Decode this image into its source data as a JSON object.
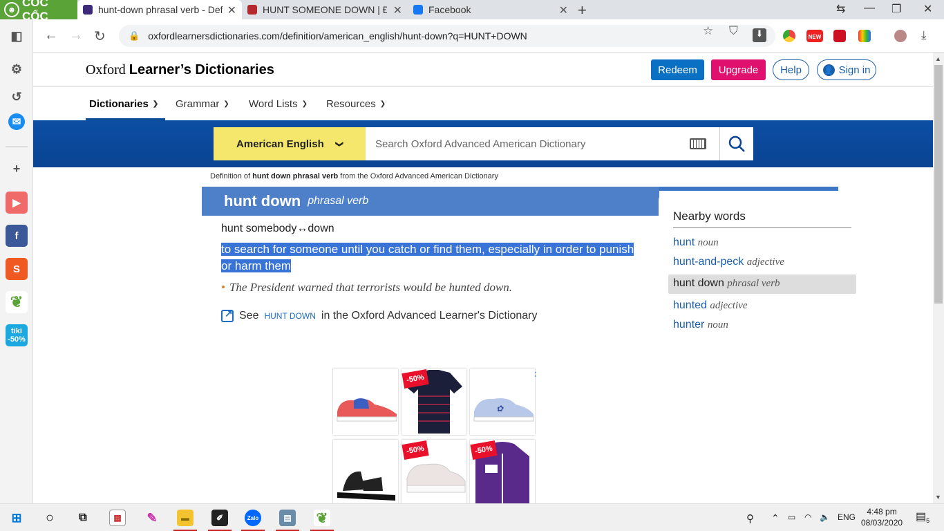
{
  "browser": {
    "brand": "CỐC CỐC",
    "tabs": [
      {
        "title": "hunt-down phrasal verb - Def"
      },
      {
        "title": "HUNT SOMEONE DOWN | Đị"
      },
      {
        "title": "Facebook"
      }
    ],
    "url": "oxfordlearnersdictionaries.com/definition/american_english/hunt-down?q=HUNT+DOWN",
    "ext_new_badge": "NEW"
  },
  "sidebar": {
    "tiki_label": "tiki",
    "tiki_discount": "-50%"
  },
  "site": {
    "title_oxford": "Oxford",
    "title_rest": "Learner’s Dictionaries",
    "redeem": "Redeem",
    "upgrade": "Upgrade",
    "help": "Help",
    "signin": "Sign in",
    "nav": [
      "Dictionaries",
      "Grammar",
      "Word Lists",
      "Resources"
    ]
  },
  "search": {
    "dictionary": "American English",
    "placeholder": "Search Oxford Advanced American Dictionary"
  },
  "entry": {
    "definition_of_prefix": "Definition of",
    "definition_of_term": "hunt down phrasal verb",
    "definition_of_suffix": "from the Oxford Advanced American Dictionary",
    "headword": "hunt down",
    "pos": "phrasal verb",
    "phrase": "hunt somebody↔down",
    "definition": "to search for someone until you catch or find them, especially in order to punish or harm them",
    "example": "The President warned that terrorists would be hunted down.",
    "see_prefix": "See",
    "see_term": "hunt down",
    "see_suffix": "in the Oxford Advanced Learner's Dictionary"
  },
  "nearby": {
    "title": "Nearby words",
    "items": [
      {
        "word": "hunt",
        "pos": "noun"
      },
      {
        "word": "hunt-and-peck",
        "pos": "adjective"
      },
      {
        "word": "hunt down",
        "pos": "phrasal verb"
      },
      {
        "word": "hunted",
        "pos": "adjective"
      },
      {
        "word": "hunter",
        "pos": "noun"
      }
    ]
  },
  "ad": {
    "badge": "-50%"
  },
  "taskbar": {
    "lang": "ENG",
    "time": "4:48 pm",
    "date": "08/03/2020",
    "zalo": "Zalo",
    "notifications": "5"
  }
}
